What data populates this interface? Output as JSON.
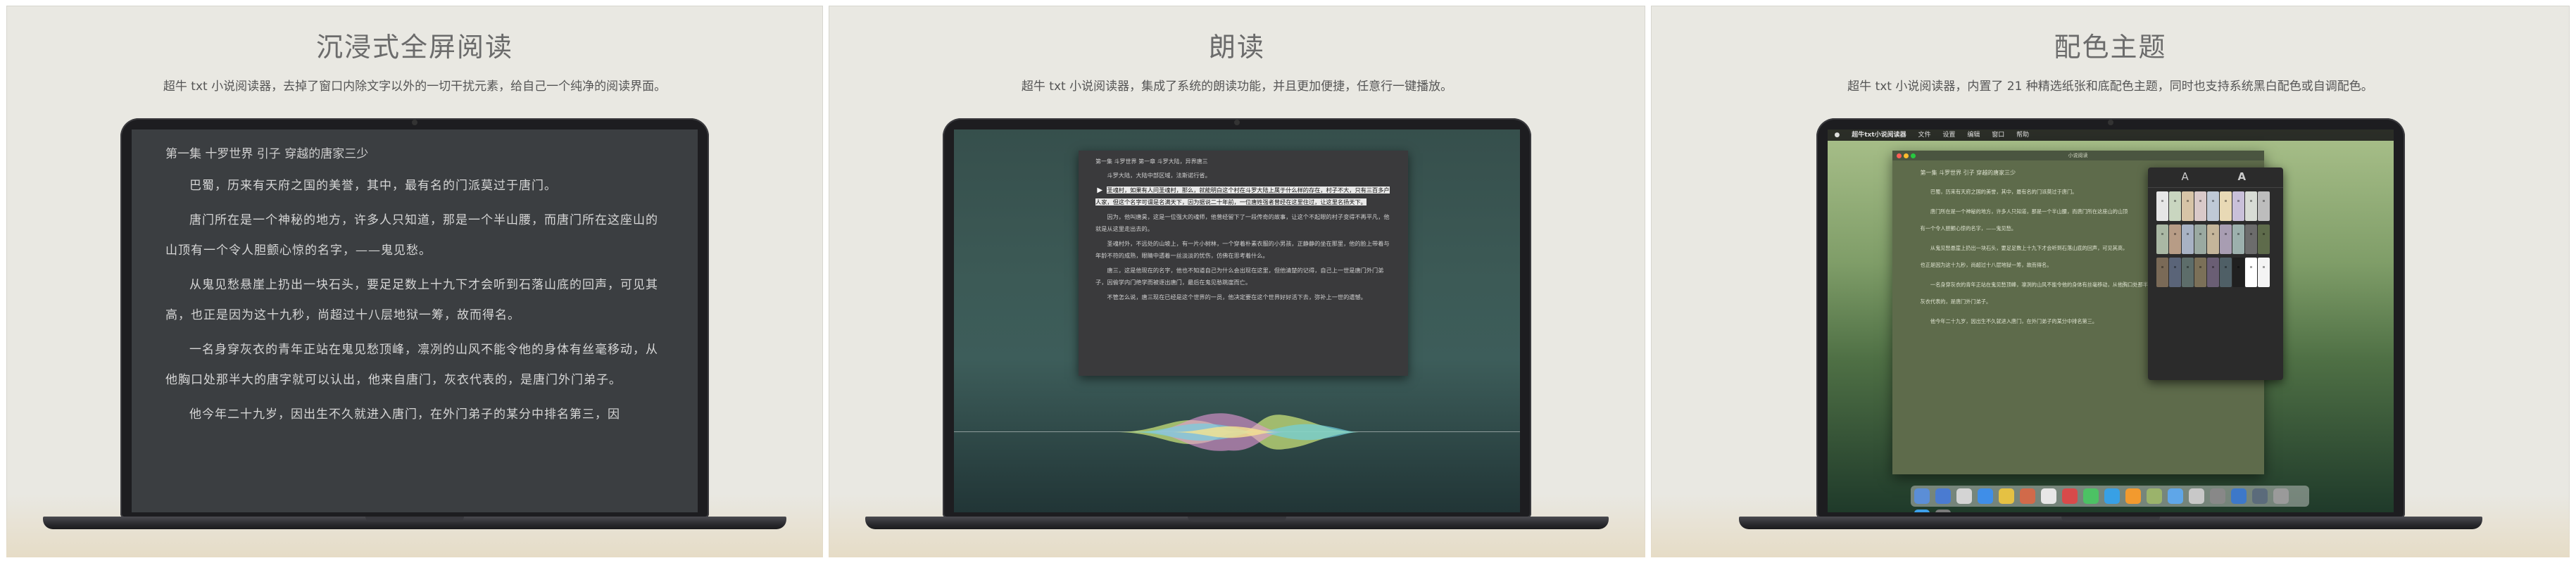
{
  "panels": [
    {
      "title": "沉浸式全屏阅读",
      "subtitle": "超牛 txt 小说阅读器，去掉了窗口内除文字以外的一切干扰元素，给自己一个纯净的阅读界面。",
      "reader": {
        "chapter": "第一集 十罗世界 引子 穿越的唐家三少",
        "paragraphs": [
          "巴蜀，历来有天府之国的美誉，其中，最有名的门派莫过于唐门。",
          "唐门所在是一个神秘的地方，许多人只知道，那是一个半山腰，而唐门所在这座山的山顶有一个令人胆颤心惊的名字，——鬼见愁。",
          "从鬼见愁悬崖上扔出一块石头，要足足数上十九下才会听到石落山底的回声，可见其高，也正是因为这十九秒，尚超过十八层地狱一筹，故而得名。",
          "一名身穿灰衣的青年正站在鬼见愁顶峰，凛冽的山风不能令他的身体有丝毫移动，从他胸口处那半大的唐字就可以认出，他来自唐门，灰衣代表的，是唐门外门弟子。",
          "他今年二十九岁，因出生不久就进入唐门，在外门弟子的某分中排名第三，因"
        ]
      }
    },
    {
      "title": "朗读",
      "subtitle": "超牛 txt 小说阅读器，集成了系统的朗读功能，并且更加便捷，任意行一键播放。",
      "reader": {
        "chapter": "第一集 斗罗世界 第一章 斗罗大陆，异界唐三",
        "paragraphs": [
          "斗罗大陆，大陆中部区域，法斯诺行省。",
          "圣魂村，如果有人问圣魂村，那么，就能明白这个村在斗罗大陆上属于什么样的存在，村子不大，只有三百多户人家，但这个名字可谓是名满天下，因为据说二十年前，一位唐姓强者曾经在这里住过，让这里名扬天下。",
          "因为，他叫唐昊，这是一位强大的魂师，他曾经留下了一段传奇的故事，让这个不起眼的村子变得不再平凡，他就是从这里走出去的。",
          "圣魂村外，不远处的山坡上，有一片小树林，一个穿着朴素衣服的小男孩，正静静的坐在那里，他的脸上带着与年龄不符的成熟，眼睛中透着一丝淡淡的忧伤，仿佛在思考着什么。",
          "唐三，这是他现在的名字，他也不知道自己为什么会出现在这里，但他清楚的记得，自己上一世是唐门外门弟子，因偷学内门绝学而被逐出唐门，最后在鬼见愁跳崖而亡。",
          "不管怎么说，唐三现在已经是这个世界的一员，他决定要在这个世界好好活下去，弥补上一世的遗憾。"
        ],
        "highlighted_index": 1
      }
    },
    {
      "title": "配色主题",
      "subtitle": "超牛 txt 小说阅读器，内置了 21 种精选纸张和底配色主题，同时也支持系统黑白配色或自调配色。",
      "menubar": [
        "超牛txt小说阅读器",
        "文件",
        "设置",
        "编辑",
        "窗口",
        "帮助"
      ],
      "window_title": "小说阅读",
      "reader": {
        "chapter": "第一集 斗罗世界 引子 穿越的唐家三少",
        "paragraphs": [
          "巴蜀，历来有天府之国的美誉，其中，最有名的门派莫过于唐门。",
          "唐门所在是一个神秘的地方，许多人只知道，那是一个半山腰，而唐门所在这座山的山顶有一个令人胆颤心惊的名字，——鬼见愁。",
          "从鬼见愁悬崖上扔出一块石头，要足足数上十九下才会听到石落山底的回声，可见其高，也正是因为这十九秒，尚超过十八层地狱一筹，故而得名。",
          "一名身穿灰衣的青年正站在鬼见愁顶峰，凛冽的山风不能令他的身体有丝毫移动，从他胸口处那半大的唐字就可以认出，他来自唐门，灰衣代表的，是唐门外门弟子。",
          "他今年二十九岁，因出生不久就进入唐门，在外门弟子的某分中排名第三。"
        ]
      },
      "popover_tabs": [
        "A",
        "A"
      ],
      "swatches": [
        "#e6e6e6",
        "#c9d6c0",
        "#d7c4a7",
        "#d9c9c9",
        "#bfc9d6",
        "#e8d9b5",
        "#c9c0d9",
        "#d8dcd5",
        "#bdbdbd",
        "#aab8a4",
        "#b79c86",
        "#a8b2c4",
        "#9aa9a1",
        "#c4b59a",
        "#a89db2",
        "#9cb0ad",
        "#6c6c6c",
        "#5e6b4b",
        "#7a6a57",
        "#5a6478",
        "#5d6d6a",
        "#7b7058",
        "#6a5e74",
        "#4f5f66",
        "#202020",
        "#ffffff",
        "#f4f4f4"
      ],
      "dock_icons": [
        "#5b8ed6",
        "#4a7bd1",
        "#d4d4d4",
        "#3f8ee8",
        "#e5c143",
        "#d16a4a",
        "#e7e7e7",
        "#d84a4a",
        "#4cc264",
        "#38a0e5",
        "#f29a2e",
        "#9bb36b",
        "#5fa6e8",
        "#c8c8c8",
        "#888888",
        "#3d78c9",
        "#5b6b7b",
        "#9a9a9a",
        "#3ea0ea",
        "#7a7a7a"
      ]
    }
  ]
}
